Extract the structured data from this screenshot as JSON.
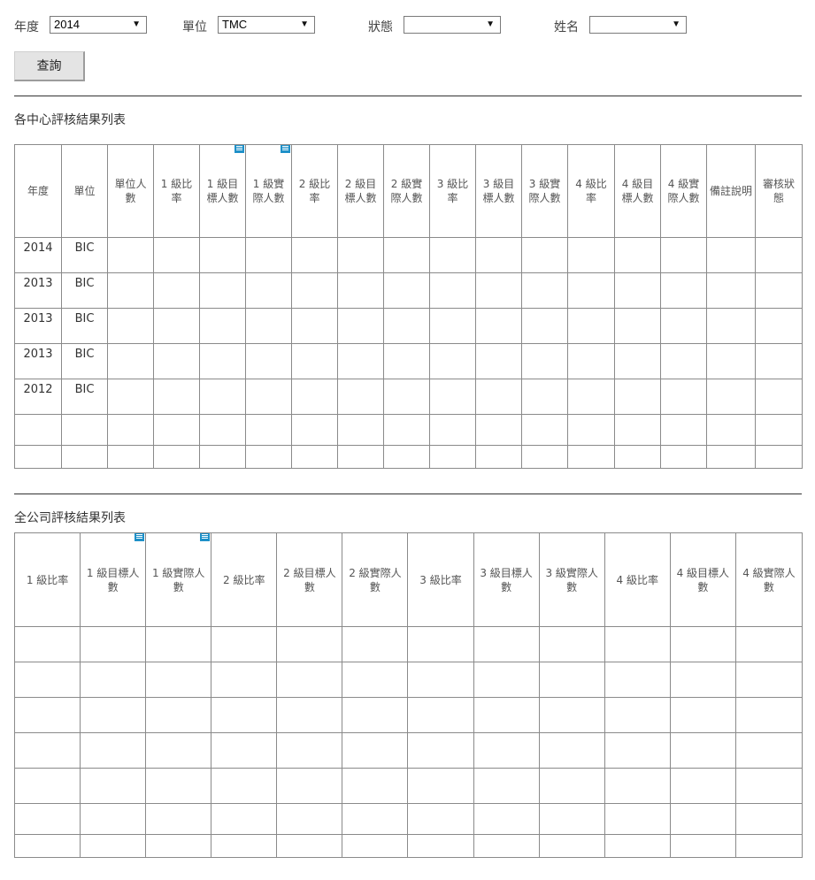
{
  "filters": {
    "year": {
      "label": "年度",
      "value": "2014"
    },
    "unit": {
      "label": "單位",
      "value": "TMC"
    },
    "status": {
      "label": "狀態",
      "value": ""
    },
    "name": {
      "label": "姓名",
      "value": ""
    }
  },
  "query_button": "查詢",
  "center_table": {
    "title": "各中心評核結果列表",
    "headers": [
      "年度",
      "單位",
      "單位人數",
      "1 級比率",
      "1 級目標人數",
      "1 級實際人數",
      "2 級比率",
      "2 級目標人數",
      "2 級實際人數",
      "3 級比率",
      "3 級目標人數",
      "3 級實際人數",
      "4 級比率",
      "4 級目標人數",
      "4 級實際人數",
      "備註說明",
      "審核狀態"
    ],
    "note_icon_columns": [
      4,
      5
    ],
    "rows": [
      [
        "2014",
        "BIC"
      ],
      [
        "2013",
        "BIC"
      ],
      [
        "2013",
        "BIC"
      ],
      [
        "2013",
        "BIC"
      ],
      [
        "2012",
        "BIC"
      ],
      [],
      []
    ]
  },
  "company_table": {
    "title": "全公司評核結果列表",
    "headers": [
      "1 級比率",
      "1 級目標人數",
      "1 級實際人數",
      "2 級比率",
      "2 級目標人數",
      "2 級實際人數",
      "3 級比率",
      "3 級目標人數",
      "3 級實際人數",
      "4 級比率",
      "4 級目標人數",
      "4 級實際人數"
    ],
    "note_icon_columns": [
      1,
      2
    ],
    "rows": [
      [],
      [],
      [],
      [],
      [],
      [],
      []
    ]
  },
  "icons": {
    "dropdown": "caret-down-icon",
    "note": "note-icon"
  },
  "colors": {
    "note_icon": "#1e90c8",
    "border": "#8a8a8a"
  }
}
